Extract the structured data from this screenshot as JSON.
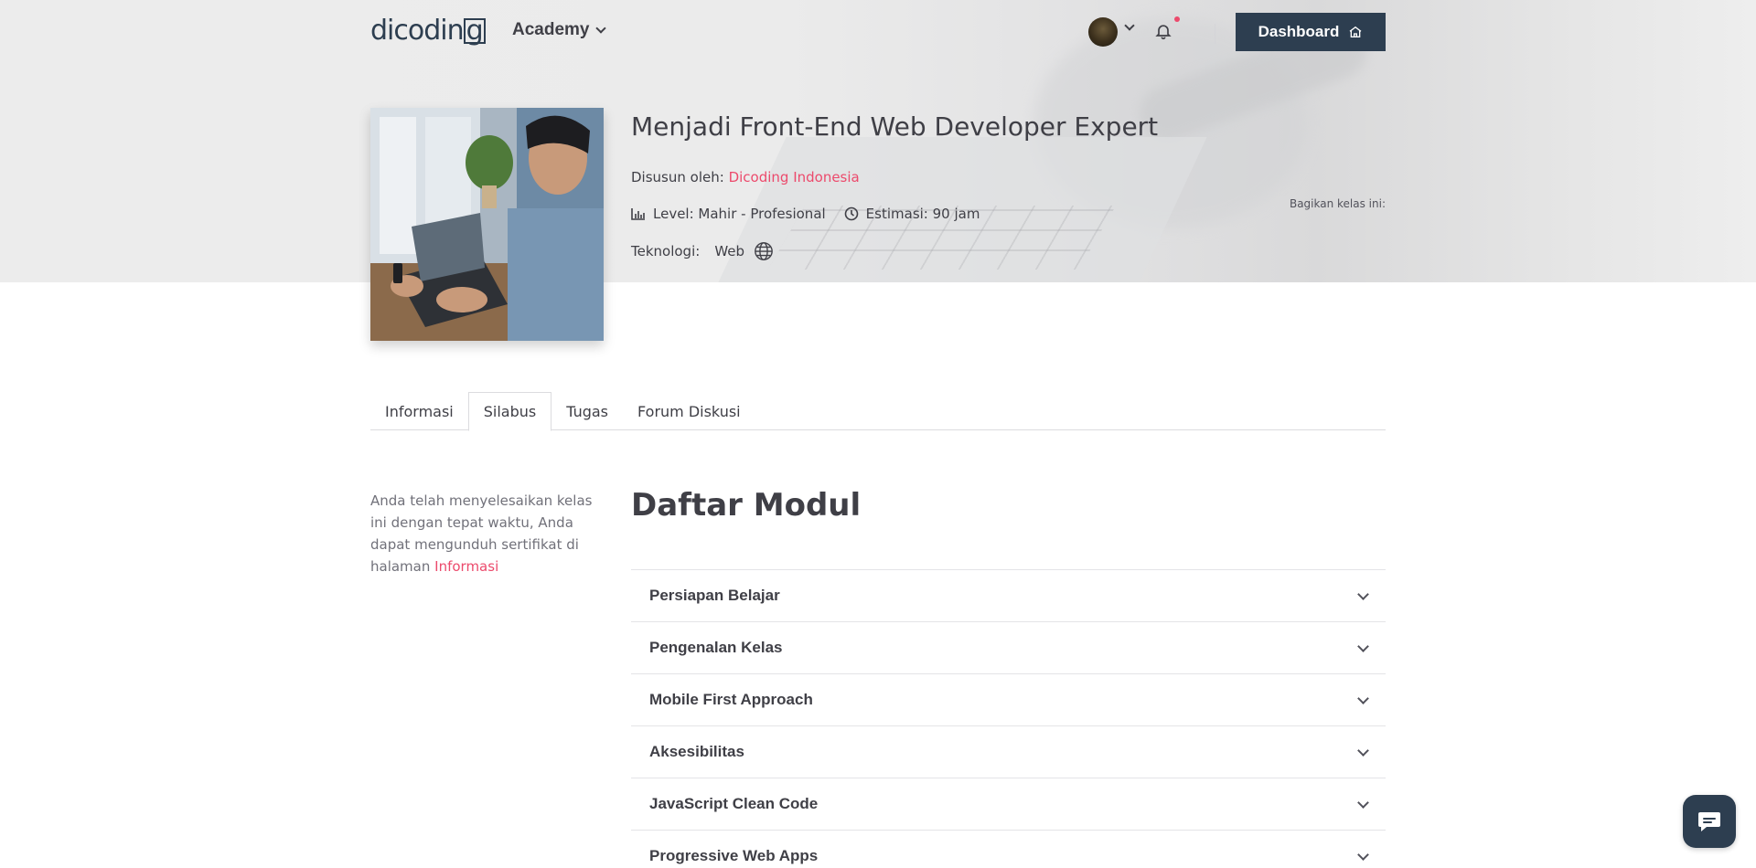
{
  "header": {
    "logo_text": "dicodin",
    "logo_box_letter": "g",
    "nav_academy_label": "Academy",
    "dashboard_label": "Dashboard"
  },
  "course": {
    "title": "Menjadi Front-End Web Developer Expert",
    "author_label": "Disusun oleh:",
    "author_name": "Dicoding Indonesia",
    "level": "Level: Mahir - Profesional",
    "estimate": "Estimasi: 90 jam",
    "tech_label": "Teknologi:",
    "tech_value": "Web",
    "share_label": "Bagikan kelas ini:"
  },
  "tabs": [
    {
      "label": "Informasi"
    },
    {
      "label": "Silabus"
    },
    {
      "label": "Tugas"
    },
    {
      "label": "Forum Diskusi"
    }
  ],
  "side_note": {
    "text": "Anda telah menyelesaikan kelas ini dengan tepat waktu, Anda dapat mengunduh sertifikat di halaman",
    "link": "Informasi"
  },
  "modules": {
    "title": "Daftar Modul",
    "items": [
      {
        "label": "Persiapan Belajar"
      },
      {
        "label": "Pengenalan Kelas"
      },
      {
        "label": "Mobile First Approach"
      },
      {
        "label": "Aksesibilitas"
      },
      {
        "label": "JavaScript Clean Code"
      },
      {
        "label": "Progressive Web Apps"
      }
    ]
  },
  "colors": {
    "primary": "#2d3e50",
    "accent": "#ec4a6c"
  }
}
